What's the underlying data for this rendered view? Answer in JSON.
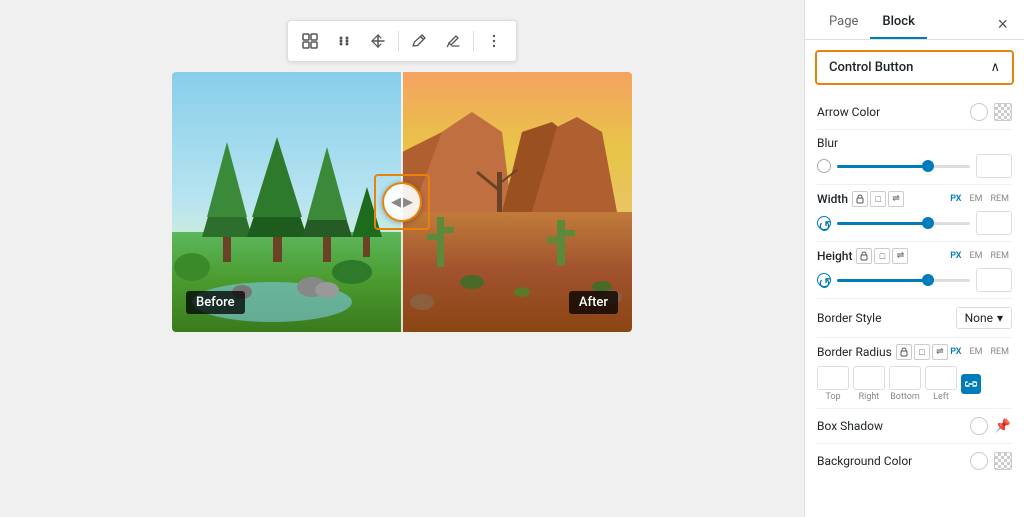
{
  "sidebar": {
    "page_tab": "Page",
    "block_tab": "Block",
    "close_label": "×",
    "control_button_label": "Control Button",
    "arrow_color_label": "Arrow Color",
    "blur_label": "Blur",
    "width_label": "Width",
    "height_label": "Height",
    "border_style_label": "Border Style",
    "border_style_value": "None",
    "border_radius_label": "Border Radius",
    "box_shadow_label": "Box Shadow",
    "bg_color_label": "Background Color",
    "units": [
      "PX",
      "EM",
      "REM"
    ],
    "border_radius_inputs": {
      "top": "",
      "right": "",
      "bottom": "",
      "left": ""
    },
    "border_radius_labels": [
      "Top",
      "Right",
      "Bottom",
      "Left"
    ]
  },
  "toolbar": {
    "buttons": [
      "grid",
      "move",
      "arrows",
      "pen",
      "erase",
      "more"
    ]
  },
  "image": {
    "before_label": "Before",
    "after_label": "After"
  },
  "colors": {
    "accent_orange": "#e8820c",
    "accent_blue": "#007cba"
  }
}
